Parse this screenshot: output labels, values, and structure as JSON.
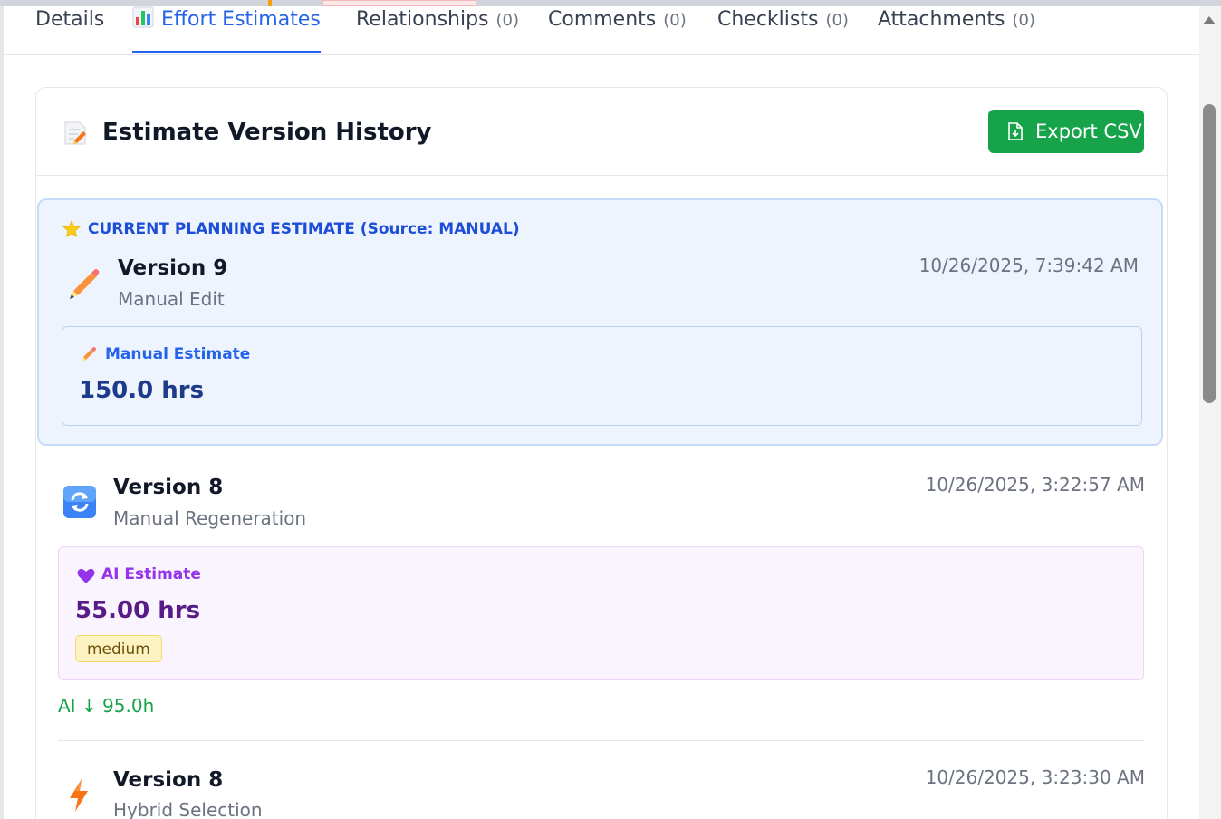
{
  "tabs": [
    {
      "label": "Details",
      "count": ""
    },
    {
      "label": "Effort Estimates",
      "count": ""
    },
    {
      "label": "Relationships",
      "count": "(0)"
    },
    {
      "label": "Comments",
      "count": "(0)"
    },
    {
      "label": "Checklists",
      "count": "(0)"
    },
    {
      "label": "Attachments",
      "count": "(0)"
    }
  ],
  "active_tab": "Effort Estimates",
  "panel": {
    "title": "Estimate Version History",
    "export_label": "Export CSV"
  },
  "current": {
    "label": "CURRENT PLANNING ESTIMATE (Source: MANUAL)",
    "version": "Version 9",
    "subtitle": "Manual Edit",
    "timestamp": "10/26/2025, 7:39:42 AM",
    "estimate_label": "Manual Estimate",
    "estimate_value": "150.0 hrs"
  },
  "history": [
    {
      "version": "Version 8",
      "subtitle": "Manual Regeneration",
      "timestamp": "10/26/2025, 3:22:57 AM",
      "estimate_label": "AI Estimate",
      "estimate_value": "55.00 hrs",
      "confidence": "medium",
      "delta": "AI ↓ 95.0h"
    },
    {
      "version": "Version 8",
      "subtitle": "Hybrid Selection",
      "timestamp": "10/26/2025, 3:23:30 AM"
    }
  ],
  "colors": {
    "accent": "#2563eb",
    "export": "#16a34a",
    "ai_purple": "#9333ea",
    "manual_value": "#1e3a8a",
    "ai_value": "#581c87"
  },
  "icons": [
    "bar-chart-icon",
    "memo-icon",
    "file-export-icon",
    "star-icon",
    "pencil-icon",
    "refresh-icon",
    "purple-heart-icon",
    "lightning-icon"
  ]
}
